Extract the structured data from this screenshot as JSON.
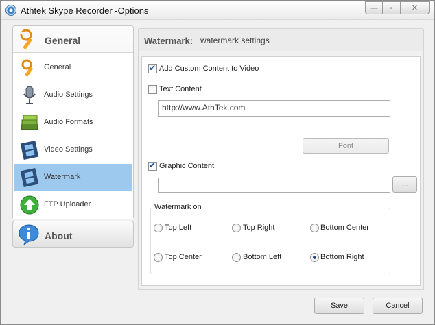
{
  "window": {
    "title": "Athtek Skype Recorder -Options"
  },
  "caption": {
    "minimize": "—",
    "maximize": "▫",
    "close": "✕"
  },
  "nav": {
    "general_header": "General",
    "items": [
      {
        "label": "General",
        "icon": "wrench-icon"
      },
      {
        "label": "Audio Settings",
        "icon": "microphone-icon"
      },
      {
        "label": "Audio Formats",
        "icon": "books-icon"
      },
      {
        "label": "Video Settings",
        "icon": "film-icon"
      },
      {
        "label": "Watermark",
        "icon": "film-icon",
        "active": true
      },
      {
        "label": "FTP Uploader",
        "icon": "upload-arrow-icon"
      }
    ],
    "about_header": "About"
  },
  "panel": {
    "title": "Watermark:",
    "subtitle": "watermark settings",
    "add_custom_content": {
      "label": "Add Custom Content to Video",
      "checked": true
    },
    "text_content": {
      "label": "Text Content",
      "checked": false
    },
    "text_value": "http://www.AthTek.com",
    "font_button": "Font",
    "graphic_content": {
      "label": "Graphic Content",
      "checked": true
    },
    "graphic_path": "",
    "browse_button": "...",
    "watermark_on": {
      "legend": "Watermark on",
      "options": [
        "Top Left",
        "Top Right",
        "Bottom Center",
        "Top Center",
        "Bottom Left",
        "Bottom Right"
      ],
      "selected": "Bottom Right"
    }
  },
  "footer": {
    "save": "Save",
    "cancel": "Cancel"
  }
}
